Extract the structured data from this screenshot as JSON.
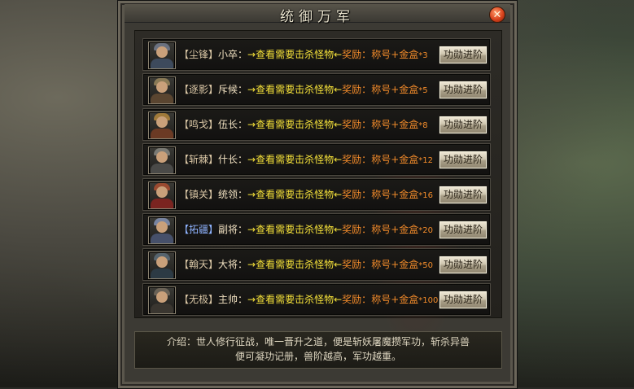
{
  "window": {
    "title": "统御万军",
    "close_icon": "close-icon"
  },
  "ranks": [
    {
      "tag": "【尘锋】",
      "name": "小卒",
      "colon": "：",
      "quest": "→查看需要击杀怪物←",
      "reward_label": "奖励：",
      "reward": "称号+金盒",
      "count": "*3",
      "button": "功勋进阶",
      "armor_color": "#3d4a5c",
      "helm_color": "#6b7280"
    },
    {
      "tag": "【逐影】",
      "name": "斥候",
      "colon": "：",
      "quest": "→查看需要击杀怪物←",
      "reward_label": "奖励：",
      "reward": "称号+金盒",
      "count": "*5",
      "button": "功勋进阶",
      "armor_color": "#5a4530",
      "helm_color": "#8a7a56"
    },
    {
      "tag": "【鸣戈】",
      "name": "伍长",
      "colon": "：",
      "quest": "→查看需要击杀怪物←",
      "reward_label": "奖励：",
      "reward": "称号+金盒",
      "count": "*8",
      "button": "功勋进阶",
      "armor_color": "#6b3a24",
      "helm_color": "#a07a3a"
    },
    {
      "tag": "【斩棘】",
      "name": "什长",
      "colon": "：",
      "quest": "→查看需要击杀怪物←",
      "reward_label": "奖励：",
      "reward": "称号+金盒",
      "count": "*12",
      "button": "功勋进阶",
      "armor_color": "#4a4a48",
      "helm_color": "#7a7a74"
    },
    {
      "tag": "【镇关】",
      "name": "统领",
      "colon": "：",
      "quest": "→查看需要击杀怪物←",
      "reward_label": "奖励：",
      "reward": "称号+金盒",
      "count": "*16",
      "button": "功勋进阶",
      "armor_color": "#7a2420",
      "helm_color": "#9a4a30"
    },
    {
      "tag": "【拓疆】",
      "name": "副将",
      "colon": "：",
      "quest": "→查看需要击杀怪物←",
      "reward_label": "奖励：",
      "reward": "称号+金盒",
      "count": "*20",
      "button": "功勋进阶",
      "armor_color": "#46506a",
      "helm_color": "#7884a0",
      "tag_color": "blue"
    },
    {
      "tag": "【翰天】",
      "name": "大将",
      "colon": "：",
      "quest": "→查看需要击杀怪物←",
      "reward_label": "奖励：",
      "reward": "称号+金盒",
      "count": "*50",
      "button": "功勋进阶",
      "armor_color": "#2c3a44",
      "helm_color": "#56646e"
    },
    {
      "tag": "【无极】",
      "name": "主帅",
      "colon": "：",
      "quest": "→查看需要击杀怪物←",
      "reward_label": "奖励：",
      "reward": "称号+金盒",
      "count": "*100",
      "button": "功勋进阶",
      "armor_color": "#3a3630",
      "helm_color": "#6a6256"
    }
  ],
  "intro": {
    "line1": "介绍：世人修行征战，唯一晋升之道，便是斩妖屠魔攒军功，斩杀异兽",
    "line2": "便可凝功记册，兽阶越高，军功越重。"
  }
}
